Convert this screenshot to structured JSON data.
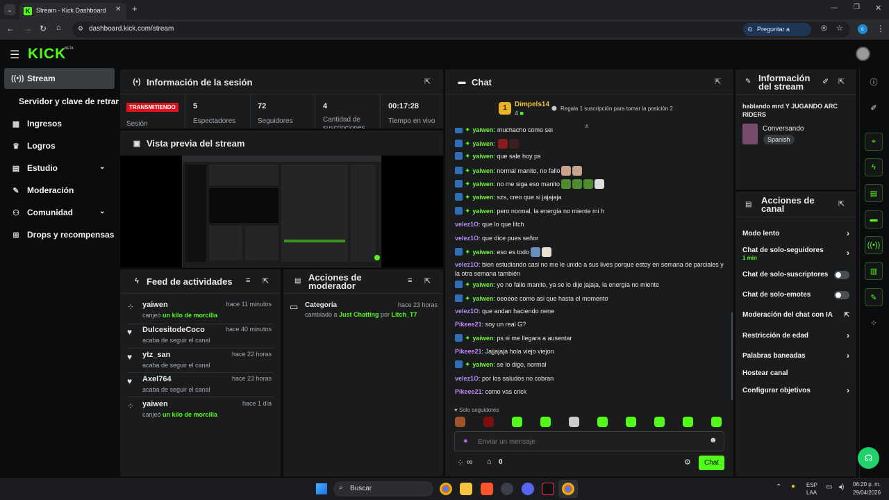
{
  "browser": {
    "tab_title": "Stream - Kick Dashboard",
    "url": "dashboard.kick.com/stream",
    "ask_google": "Preguntar a Google",
    "profile_initial": "c"
  },
  "header": {
    "logo": "KICK",
    "logo_beta": "BETA"
  },
  "sidebar": {
    "items": [
      {
        "label": "Stream",
        "icon": "broadcast-icon"
      },
      {
        "label": "Servidor y clave de retransmisión",
        "icon": ""
      },
      {
        "label": "Ingresos",
        "icon": "chart-icon"
      },
      {
        "label": "Logros",
        "icon": "trophy-icon"
      },
      {
        "label": "Estudio",
        "icon": "studio-icon"
      },
      {
        "label": "Moderación",
        "icon": "wrench-icon"
      },
      {
        "label": "Comunidad",
        "icon": "people-icon"
      },
      {
        "label": "Drops y recompensas",
        "icon": "gift-icon"
      }
    ]
  },
  "session": {
    "title": "Información de la sesión",
    "status_badge": "TRANSMITIENDO",
    "status_label": "Sesión",
    "stats": [
      {
        "value": "5",
        "label": "Espectadores"
      },
      {
        "value": "72",
        "label": "Seguidores"
      },
      {
        "value": "4",
        "label": "Cantidad de suscripciones"
      },
      {
        "value": "00:17:28",
        "label": "Tiempo en vivo"
      }
    ]
  },
  "preview": {
    "title": "Vista previa del stream"
  },
  "feed": {
    "title": "Feed de actividades",
    "items": [
      {
        "name": "yaiwen",
        "time": "hace 11 minutos",
        "pre": "canjeó ",
        "highlight": "un kilo de morcilla",
        "icon": "redeem-icon"
      },
      {
        "name": "DulcesitodeCoco",
        "time": "hace 40 minutos",
        "pre": "acaba de seguir el canal",
        "highlight": "",
        "icon": "heart-icon"
      },
      {
        "name": "ytz_san",
        "time": "hace 22 horas",
        "pre": "acaba de seguir el canal",
        "highlight": "",
        "icon": "heart-icon"
      },
      {
        "name": "Axel764",
        "time": "hace 23 horas",
        "pre": "acaba de seguir el canal",
        "highlight": "",
        "icon": "heart-icon"
      },
      {
        "name": "yaiwen",
        "time": "hace 1 día",
        "pre": "canjeó ",
        "highlight": "un kilo de morcilla",
        "icon": "redeem-icon"
      }
    ]
  },
  "mod_actions": {
    "title_line1": "Acciones de",
    "title_line2": "moderador",
    "item": {
      "name": "Categoría",
      "time": "hace 23 horas",
      "pre": "cambiado a ",
      "category": "Just Chatting",
      "mid": " por ",
      "user": "Litch_T7"
    }
  },
  "chat": {
    "title": "Chat",
    "top_user": "Dimpels14",
    "top_rank": "1",
    "top_count": "4",
    "gift_text": "Regala 1 suscripción para tomar la posición 2",
    "partial_first": "muchacho como sei",
    "messages": [
      {
        "user": "yaiwen",
        "text": "",
        "badges": true,
        "emotes": [
          "#8b1a1a",
          "#3a2020"
        ]
      },
      {
        "user": "yaiwen",
        "text": "que sale hoy ps",
        "badges": true,
        "emotes": []
      },
      {
        "user": "yaiwen",
        "text": "normal manito, no fallo",
        "badges": true,
        "emotes": [
          "#c9a48a",
          "#c9a48a"
        ]
      },
      {
        "user": "yaiwen",
        "text": "no me siga eso manito",
        "badges": true,
        "emotes": [
          "#4e8b2e",
          "#4e8b2e",
          "#4e8b2e",
          "#dddddd"
        ]
      },
      {
        "user": "yaiwen",
        "text": "szs, creo que si jajajaja",
        "badges": true,
        "emotes": []
      },
      {
        "user": "yaiwen",
        "text": "pero normal, la energía no miente mi h",
        "badges": true,
        "emotes": []
      },
      {
        "user": "velez1O",
        "text": "que lo que litch",
        "badges": false,
        "emotes": []
      },
      {
        "user": "velez1O",
        "text": "que dice pues señor",
        "badges": false,
        "emotes": []
      },
      {
        "user": "yaiwen",
        "text": "eso es todo",
        "badges": true,
        "emotes": [
          "#6b8fb8",
          "#e8e0d0"
        ]
      },
      {
        "user": "velez1O",
        "text": "bien estudiando casi no me le unido a sus lives porque estoy en semana de parciales y la otra semana también",
        "badges": false,
        "emotes": []
      },
      {
        "user": "yaiwen",
        "text": "yo no fallo manito, ya se lo dije jajaja, la energía no miente",
        "badges": true,
        "emotes": []
      },
      {
        "user": "yaiwen",
        "text": "oeoeoe como asi que hasta el momento",
        "badges": true,
        "emotes": []
      },
      {
        "user": "velez1O",
        "text": "que andan haciendo nene",
        "badges": false,
        "emotes": []
      },
      {
        "user": "Pikeee21",
        "text": "soy un real G?",
        "badges": false,
        "emotes": []
      },
      {
        "user": "yaiwen",
        "text": "ps si me llegara a ausentar",
        "badges": true,
        "emotes": []
      },
      {
        "user": "Pikeee21",
        "text": "Jajjajaja hola viejo viejon",
        "badges": false,
        "emotes": []
      },
      {
        "user": "yaiwen",
        "text": "se lo digo, normal",
        "badges": true,
        "emotes": []
      },
      {
        "user": "velez1O",
        "text": "por los saludos no cobran",
        "badges": false,
        "emotes": []
      },
      {
        "user": "Pikeee21",
        "text": "como vas crick",
        "badges": false,
        "emotes": []
      }
    ],
    "followers_only": "Solo seguidores",
    "emote_colors": [
      "#a0522d",
      "#7a1010",
      "#53fc18",
      "#53fc18",
      "#cccccc",
      "#53fc18",
      "#53fc18",
      "#53fc18",
      "#53fc18",
      "#53fc18"
    ],
    "input_placeholder": "Enviar un mensaje",
    "infinity": "∞",
    "points": "0",
    "send_label": "Chat"
  },
  "stream_info": {
    "title_line1": "Información",
    "title_line2": "del stream",
    "stream_title": "hablando mrd Y JUGANDO ARC RIDERS",
    "category": "Conversando",
    "language": "Spanish"
  },
  "channel_actions": {
    "title_line1": "Acciones de",
    "title_line2": "canal",
    "items": [
      {
        "label": "Modo lento",
        "control": "chevron"
      },
      {
        "label": "Chat de solo-seguidores",
        "sub": "1 min",
        "control": "chevron"
      },
      {
        "label": "Chat de solo-suscriptores",
        "control": "toggle"
      },
      {
        "label": "Chat de solo-emotes",
        "control": "toggle"
      },
      {
        "label": "Moderación del chat con IA",
        "control": "external"
      },
      {
        "label": "Restricción de edad",
        "control": "chevron"
      },
      {
        "label": "Palabras baneadas",
        "control": "chevron"
      },
      {
        "label": "Hostear canal",
        "control": "none"
      },
      {
        "label": "Configurar objetivos",
        "control": "chevron"
      }
    ]
  },
  "taskbar": {
    "search": "Buscar",
    "lang1": "ESP",
    "lang2": "LAA",
    "time": "06:20 p. m.",
    "date": "29/04/2026"
  },
  "colors": {
    "accent": "#53fc18",
    "live_red": "#e0121b",
    "panel": "#191b1c",
    "bg": "#0b0c0d"
  }
}
